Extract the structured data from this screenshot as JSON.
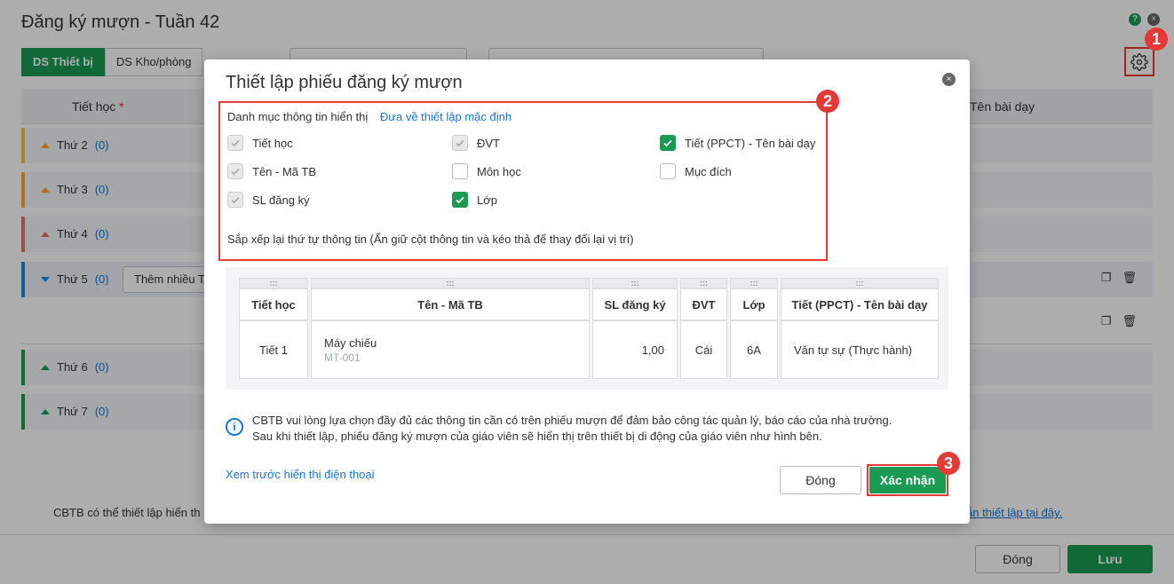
{
  "page": {
    "title": "Đăng ký mượn - Tuần 42",
    "tabs": [
      "DS Thiết bị",
      "DS Kho/phòng"
    ],
    "table_headers": {
      "tiet_hoc": "Tiết học",
      "required_mark": "*",
      "ten_bai_day": "Tên bài dạy"
    },
    "days": [
      {
        "label": "Thứ 2",
        "count": "(0)"
      },
      {
        "label": "Thứ 3",
        "count": "(0)"
      },
      {
        "label": "Thứ 4",
        "count": "(0)"
      },
      {
        "label": "Thứ 5",
        "count": "(0)"
      },
      {
        "label": "Thứ 6",
        "count": "(0)"
      },
      {
        "label": "Thứ 7",
        "count": "(0)"
      }
    ],
    "add_many_button": "Thêm nhiều T",
    "footer_note": "CBTB có thể thiết lập hiển th",
    "footer_link": "g dẫn thiết lập tại đây.",
    "close_button": "Đóng",
    "save_button": "Lưu",
    "help_icon": "?",
    "close_icon": "×"
  },
  "badges": [
    "1",
    "2",
    "3"
  ],
  "modal": {
    "title": "Thiết lập phiếu đăng ký mượn",
    "close_icon": "×",
    "section_label": "Danh mục thông tin hiển thị",
    "reset_link": "Đưa về thiết lập mặc định",
    "checkboxes": [
      {
        "label": "Tiết học",
        "state": "disabled-checked"
      },
      {
        "label": "ĐVT",
        "state": "disabled-checked"
      },
      {
        "label": "Tiết (PPCT) - Tên bài dạy",
        "state": "checked"
      },
      {
        "label": "Tên - Mã TB",
        "state": "disabled-checked"
      },
      {
        "label": "Môn học",
        "state": "unchecked"
      },
      {
        "label": "Mục đích",
        "state": "unchecked"
      },
      {
        "label": "SL đăng ký",
        "state": "disabled-checked"
      },
      {
        "label": "Lớp",
        "state": "checked"
      }
    ],
    "sort_note": "Sắp xếp lại thứ tự thông tin (Ấn giữ cột thông tin và kéo thả để thay đổi lại vị trí)",
    "preview_table": {
      "grip": ":::",
      "headers": [
        "Tiết học",
        "Tên - Mã TB",
        "SL đăng ký",
        "ĐVT",
        "Lớp",
        "Tiết (PPCT) - Tên bài dạy"
      ],
      "row": {
        "tiet_hoc": "Tiết 1",
        "ten_tb": "Máy chiếu",
        "ma_tb": "MT-001",
        "sl": "1,00",
        "dvt": "Cái",
        "lop": "6A",
        "bai_day": "Văn tự sự (Thực hành)"
      }
    },
    "info_icon": "i",
    "info_line1": "CBTB vui lòng lựa chọn đầy đủ các thông tin cần có trên phiếu mượn để đảm bảo công tác quản lý, báo cáo của nhà trường.",
    "info_line2": "Sau khi thiết lập, phiếu đăng ký mượn của giáo viên sẽ hiển thị trên thiết bị di động của giáo viên như hình bên.",
    "preview_phone_link": "Xem trước hiển thị điện thoại",
    "close_button": "Đóng",
    "confirm_button": "Xác nhận"
  }
}
